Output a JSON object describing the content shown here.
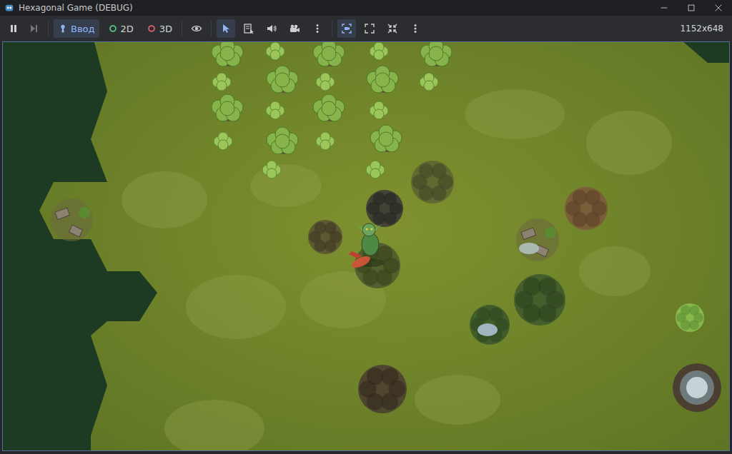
{
  "window": {
    "title": "Hexagonal Game (DEBUG)"
  },
  "toolbar": {
    "playback": [
      {
        "selected": false,
        "disabled": false
      },
      {
        "selected": false,
        "disabled": true
      }
    ],
    "modes": [
      {
        "label": "Ввод",
        "selected": true,
        "color": "#8fb8f5"
      },
      {
        "label": "2D",
        "selected": false,
        "color": "#5fc48a"
      },
      {
        "label": "3D",
        "selected": false,
        "color": "#e0606a"
      }
    ],
    "visibility": [
      {
        "selected": false
      }
    ],
    "tools": [
      {
        "selected": true
      },
      {
        "selected": false
      },
      {
        "selected": false
      },
      {
        "selected": false
      },
      {
        "selected": false
      }
    ],
    "camera": [
      {
        "selected": true
      },
      {
        "selected": false
      },
      {
        "selected": false
      },
      {
        "selected": false
      }
    ],
    "resolution": "1152x648"
  }
}
